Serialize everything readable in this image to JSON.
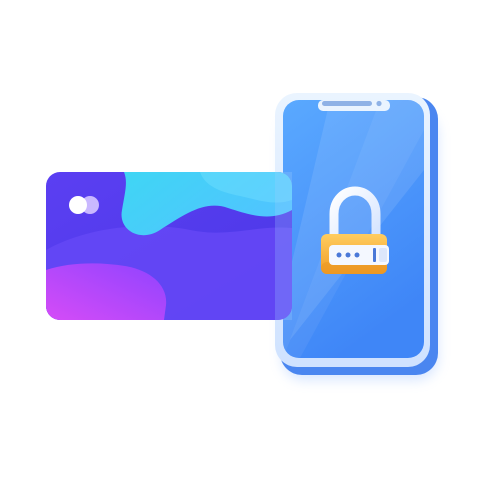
{
  "scene": {
    "description_free": true,
    "password_mask_dots": 3,
    "colors": {
      "background": "#ffffff",
      "phone_body_shadow": "#4a86f0",
      "phone_frame": "#dfeeff",
      "phone_screen_top": "#5aa9ff",
      "phone_screen_bottom": "#3f86f7",
      "speaker": "#8fb2e6",
      "card_base": "#5a3cf0",
      "card_cyan": "#44d2f5",
      "card_magenta": "#c34bff",
      "card_violet": "#6d4dff",
      "chip_light": "#ffffff",
      "chip_lilac": "#c9b8ff",
      "lock_shackle": "#e9f1ff",
      "lock_body_top": "#ffc85a",
      "lock_body_bottom": "#f0a027",
      "lock_field": "#f4f8ff",
      "lock_dot": "#4a79d8"
    },
    "icons": [
      "smartphone-icon",
      "credit-card-icon",
      "padlock-icon",
      "password-field-icon"
    ]
  }
}
